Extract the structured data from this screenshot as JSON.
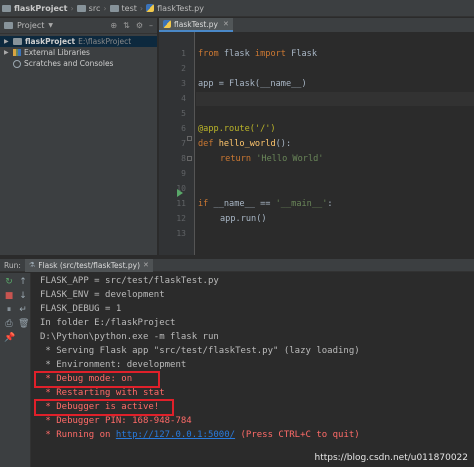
{
  "breadcrumb": {
    "project": "flaskProject",
    "src": "src",
    "test": "test",
    "file": "flaskTest.py"
  },
  "project_panel": {
    "header": "Project",
    "tree": [
      {
        "name": "flaskProject",
        "path": "E:\\flaskProject"
      },
      {
        "name": "External Libraries"
      },
      {
        "name": "Scratches and Consoles"
      }
    ]
  },
  "editor": {
    "tab": "flaskTest.py",
    "line_numbers": [
      "1",
      "2",
      "3",
      "4",
      "5",
      "6",
      "7",
      "8",
      "9",
      "10",
      "11",
      "12",
      "13"
    ],
    "code": {
      "l1_kw1": "from",
      "l1_mid": " flask ",
      "l1_kw2": "import",
      "l1_end": " Flask",
      "l3": "app = Flask(__name__)",
      "l6": "@app.route('/')",
      "l7_kw": "def ",
      "l7_fn": "hello_world",
      "l7_end": "():",
      "l8_kw": "return ",
      "l8_str": "'Hello World'",
      "l11_kw": "if ",
      "l11_mid": "__name__ == ",
      "l11_str": "'__main__'",
      "l11_end": ":",
      "l12": "app.run()"
    }
  },
  "run_panel": {
    "label": "Run:",
    "tab": "Flask (src/test/flaskTest.py)",
    "console": [
      "FLASK_APP = src/test/flaskTest.py",
      "FLASK_ENV = development",
      "FLASK_DEBUG = 1",
      "In folder E:/flaskProject",
      "D:\\Python\\python.exe -m flask run",
      " * Serving Flask app \"src/test/flaskTest.py\" (lazy loading)",
      " * Environment: development",
      " * Debug mode: on",
      " * Restarting with stat",
      " * Debugger is active!",
      " * Debugger PIN: 168-948-784"
    ],
    "running_prefix": " * Running on ",
    "running_url": "http://127.0.0.1:5000/",
    "running_suffix": " (Press CTRL+C to quit)"
  },
  "watermark": "https://blog.csdn.net/u011870022",
  "colors": {
    "background": "#2b2b2b",
    "panel": "#3c3f41",
    "keyword": "#cc7832",
    "string": "#6a8759",
    "function": "#ffc66d",
    "decorator": "#bbb529",
    "error_red": "#ff6b68",
    "link": "#287bde",
    "highlight_box": "#e0202a"
  }
}
